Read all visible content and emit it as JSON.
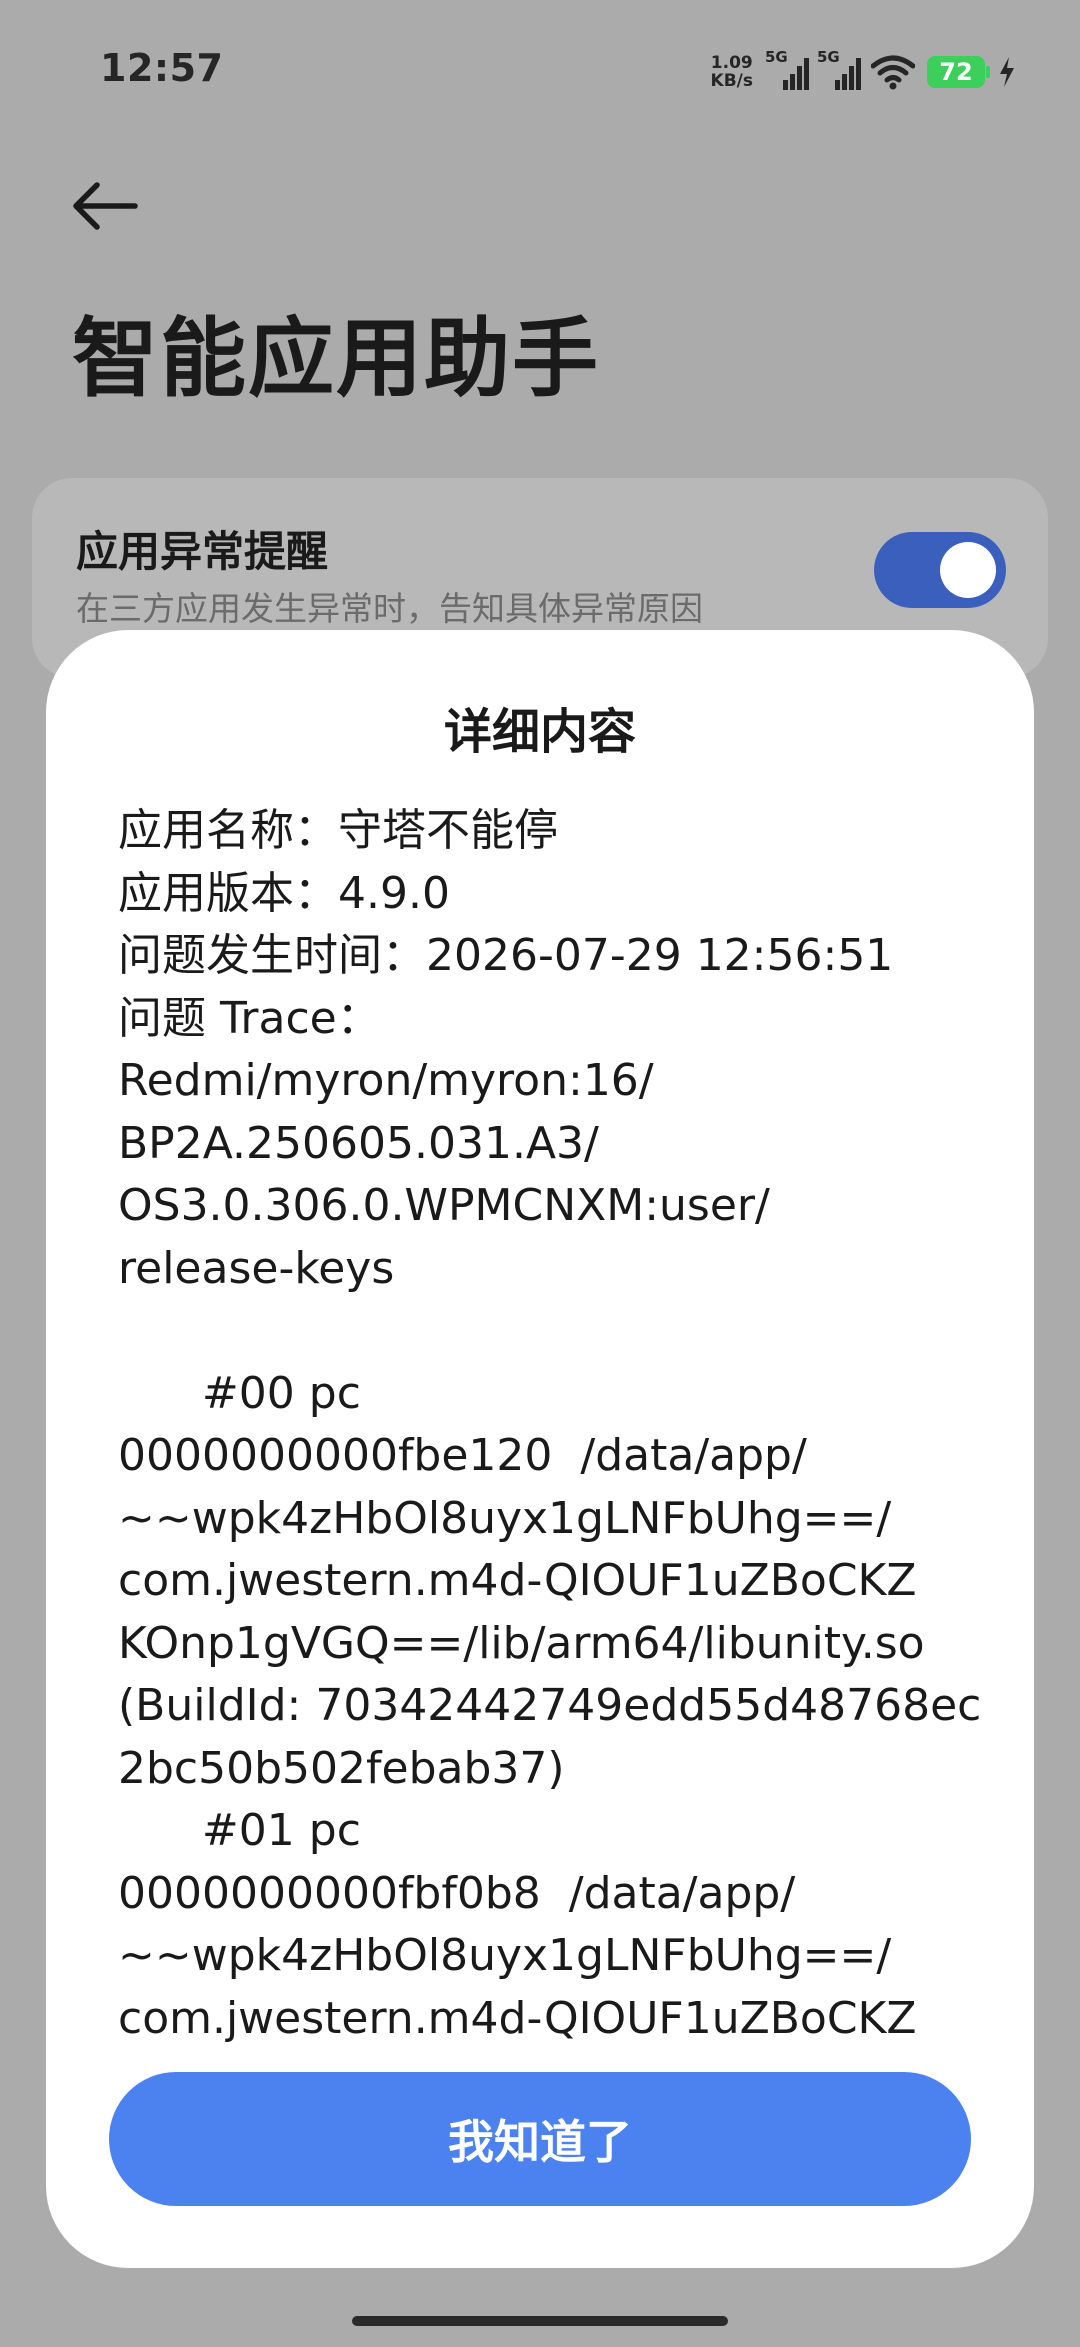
{
  "status_bar": {
    "time": "12:57",
    "net_speed_value": "1.09",
    "net_speed_unit": "KB/s",
    "signal1_tag": "5G",
    "signal2_tag": "5G",
    "battery_level": "72",
    "icons": [
      "signal-icon",
      "signal-icon",
      "wifi-icon",
      "battery-icon",
      "charging-icon"
    ]
  },
  "header": {
    "back_icon": "back-arrow-icon",
    "title": "智能应用助手"
  },
  "setting": {
    "label": "应用异常提醒",
    "description": "在三方应用发生异常时，告知具体异常原因",
    "toggle_on": true
  },
  "dialog": {
    "title": "详细内容",
    "app_name_line": "应用名称：守塔不能停",
    "app_version_line": "应用版本：4.9.0",
    "time_line": "问题发生时间：2026-07-29 12:56:51",
    "trace_label": "问题 Trace：",
    "trace_body": "Redmi/myron/myron:16/\nBP2A.250605.031.A3/\nOS3.0.306.0.WPMCNXM:user/\nrelease-keys\n\n      #00 pc\n0000000000fbe120  /data/app/\n~~wpk4zHbOl8uyx1gLNFbUhg==/\ncom.jwestern.m4d-QIOUF1uZBoCKZ\nKOnp1gVGQ==/lib/arm64/libunity.so\n(BuildId: 70342442749edd55d48768ec\n2bc50b502febab37)\n      #01 pc\n0000000000fbf0b8  /data/app/\n~~wpk4zHbOl8uyx1gLNFbUhg==/\ncom.jwestern.m4d-QIOUF1uZBoCKZ",
    "confirm_label": "我知道了"
  },
  "colors": {
    "scrim_background": "#ababab",
    "toggle_on": "#3b5fbd",
    "button_primary": "#4b82f0",
    "battery": "#3ccf5c"
  }
}
